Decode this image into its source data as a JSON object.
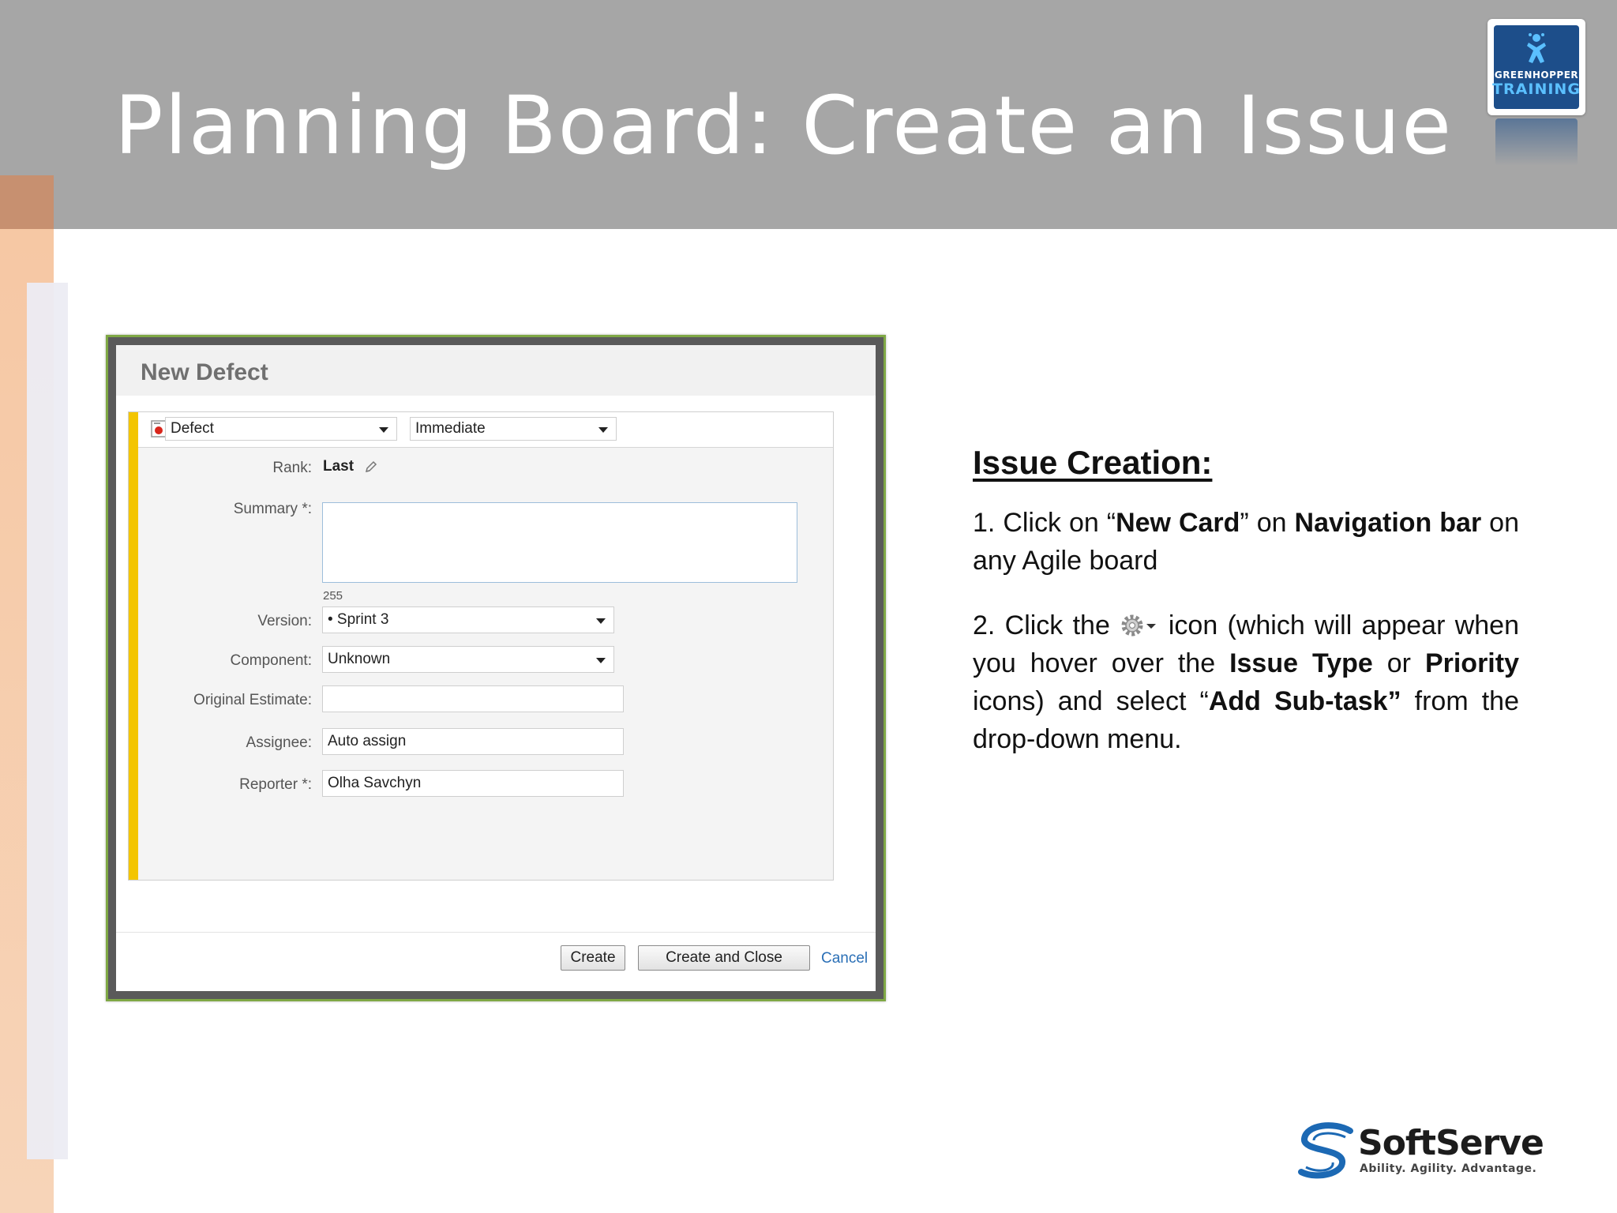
{
  "slide": {
    "title": "Planning Board: Create an Issue",
    "badge_line1": "GREENHOPPER",
    "badge_line2": "TRAINING"
  },
  "dialog": {
    "title": "New Defect",
    "issue_type": "Defect",
    "priority": "Immediate",
    "fields": {
      "rank_label": "Rank:",
      "rank_value": "Last",
      "summary_label": "Summary *:",
      "summary_value": "",
      "summary_counter": "255",
      "version_label": "Version:",
      "version_value": "• Sprint 3",
      "component_label": "Component:",
      "component_value": "Unknown",
      "estimate_label": "Original Estimate:",
      "estimate_value": "",
      "assignee_label": "Assignee:",
      "assignee_value": "Auto assign",
      "reporter_label": "Reporter *:",
      "reporter_value": "Olha Savchyn"
    },
    "buttons": {
      "create": "Create",
      "create_close": "Create and Close",
      "cancel": "Cancel"
    }
  },
  "instructions": {
    "heading": "Issue Creation:",
    "step1": {
      "t1": "1. Click on “",
      "b1": "New Card",
      "t2": "” on ",
      "b2": "Navigation bar",
      "t3": " on any Agile board"
    },
    "step2": {
      "t1": "2. Click the",
      "t2": "icon (which will appear when you hover over the ",
      "b1": "Issue Type",
      "t3": " or ",
      "b2": "Priority",
      "t4": " icons) and select “",
      "b3": "Add Sub-task”",
      "t5": " from the drop-down menu."
    }
  },
  "logo": {
    "name": "SoftServe",
    "tagline": "Ability. Agility. Advantage."
  },
  "colors": {
    "header": "#a6a6a6",
    "left_bar": "#f6c7a3",
    "dialog_border": "#7fa845",
    "accent_yellow": "#f3c500",
    "link": "#2a6fb6",
    "badge": "#1d4e8a"
  }
}
